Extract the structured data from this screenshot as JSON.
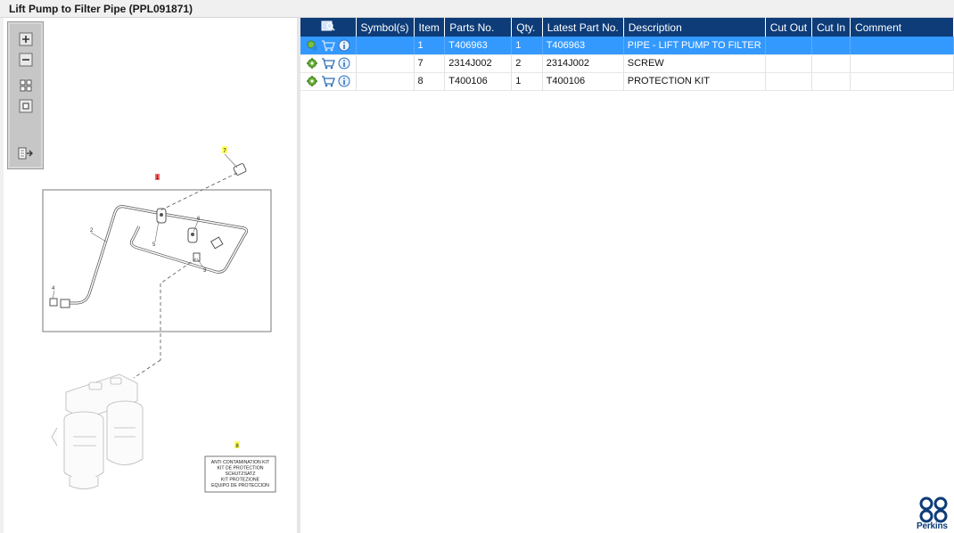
{
  "window": {
    "title": "Lift Pump to Filter Pipe (PPL091871)"
  },
  "toolbar": {
    "buttons": [
      {
        "name": "zoom-in-icon"
      },
      {
        "name": "zoom-out-icon"
      },
      {
        "name": "fit-all-icon"
      },
      {
        "name": "fit-window-icon"
      },
      {
        "name": "export-icon"
      }
    ]
  },
  "diagram": {
    "callouts": {
      "c1": "1",
      "c2": "2",
      "c3": "3",
      "c4": "4",
      "c5": "5",
      "c6": "6",
      "c7": "7",
      "c8": "8"
    },
    "kit_label": {
      "line1": "ANTI CONTAMINATION KIT",
      "line2": "KIT DE PROTECTION",
      "line3": "SCHUTZSATZ",
      "line4": "KIT PROTEZIONE",
      "line5": "EQUIPO DE PROTECCION"
    }
  },
  "table": {
    "headers": {
      "icons": "",
      "symbols": "Symbol(s)",
      "item": "Item",
      "parts_no": "Parts No.",
      "qty": "Qty.",
      "latest_part_no": "Latest Part No.",
      "description": "Description",
      "cut_out": "Cut Out",
      "cut_in": "Cut In",
      "comment": "Comment"
    },
    "rows": [
      {
        "symbols": "",
        "item": "1",
        "parts_no": "T406963",
        "qty": "1",
        "latest_part_no": "T406963",
        "description": "PIPE - LIFT PUMP TO FILTER",
        "cut_out": "",
        "cut_in": "",
        "comment": "",
        "selected": true
      },
      {
        "symbols": "",
        "item": "7",
        "parts_no": "2314J002",
        "qty": "2",
        "latest_part_no": "2314J002",
        "description": "SCREW",
        "cut_out": "",
        "cut_in": "",
        "comment": "",
        "selected": false
      },
      {
        "symbols": "",
        "item": "8",
        "parts_no": "T400106",
        "qty": "1",
        "latest_part_no": "T400106",
        "description": "PROTECTION KIT",
        "cut_out": "",
        "cut_in": "",
        "comment": "",
        "selected": false
      }
    ]
  },
  "brand": {
    "name": "Perkins",
    "color": "#0d3c78"
  },
  "colors": {
    "header_bg": "#0d3c78",
    "selected_row": "#3399ff",
    "callout_yellow": "#ffff66",
    "callout_red": "#ff6666"
  }
}
